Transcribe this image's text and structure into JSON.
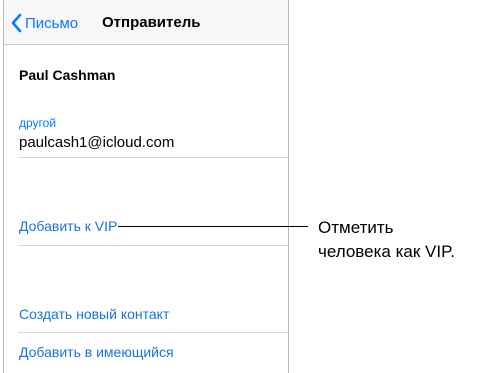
{
  "navbar": {
    "back_label": "Письмо",
    "title": "Отправитель"
  },
  "contact": {
    "name": "Paul Cashman",
    "email_label": "другой",
    "email": "paulcash1@icloud.com"
  },
  "actions": {
    "add_vip": "Добавить к VIP",
    "create_contact": "Создать новый контакт",
    "add_existing": "Добавить в имеющийся"
  },
  "callout": {
    "line1": "Отметить",
    "line2": "человека как VIP."
  },
  "colors": {
    "accent": "#0a7aff",
    "link": "#1a73d8"
  }
}
